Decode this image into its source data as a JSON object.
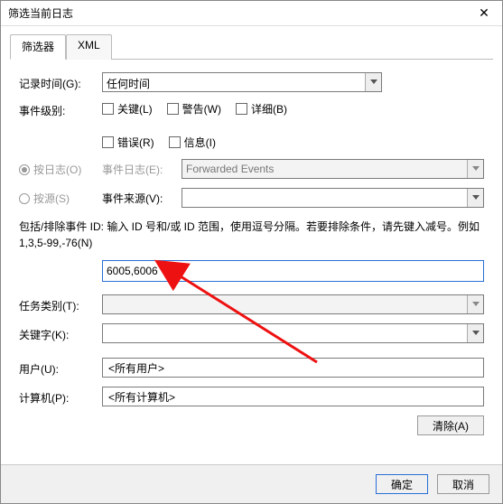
{
  "window": {
    "title": "筛选当前日志"
  },
  "tabs": {
    "filter": "筛选器",
    "xml": "XML"
  },
  "labels": {
    "logged": "记录时间(G):",
    "level": "事件级别:",
    "by_log": "按日志(O)",
    "by_source": "按源(S)",
    "event_log": "事件日志(E):",
    "event_source": "事件来源(V):",
    "help": "包括/排除事件 ID: 输入 ID 号和/或 ID 范围，使用逗号分隔。若要排除条件，请先键入减号。例如 1,3,5-99,-76(N)",
    "task_cat": "任务类别(T):",
    "keywords": "关键字(K):",
    "user": "用户(U):",
    "computer": "计算机(P):"
  },
  "fields": {
    "logged": "任何时间",
    "event_log": "Forwarded Events",
    "event_source": "",
    "event_ids": "6005,6006",
    "task_cat": "",
    "keywords": "",
    "user": "<所有用户>",
    "computer": "<所有计算机>"
  },
  "checks": {
    "critical": "关键(L)",
    "warning": "警告(W)",
    "verbose": "详细(B)",
    "error": "错误(R)",
    "info": "信息(I)"
  },
  "buttons": {
    "clear": "清除(A)",
    "ok": "确定",
    "cancel": "取消"
  }
}
